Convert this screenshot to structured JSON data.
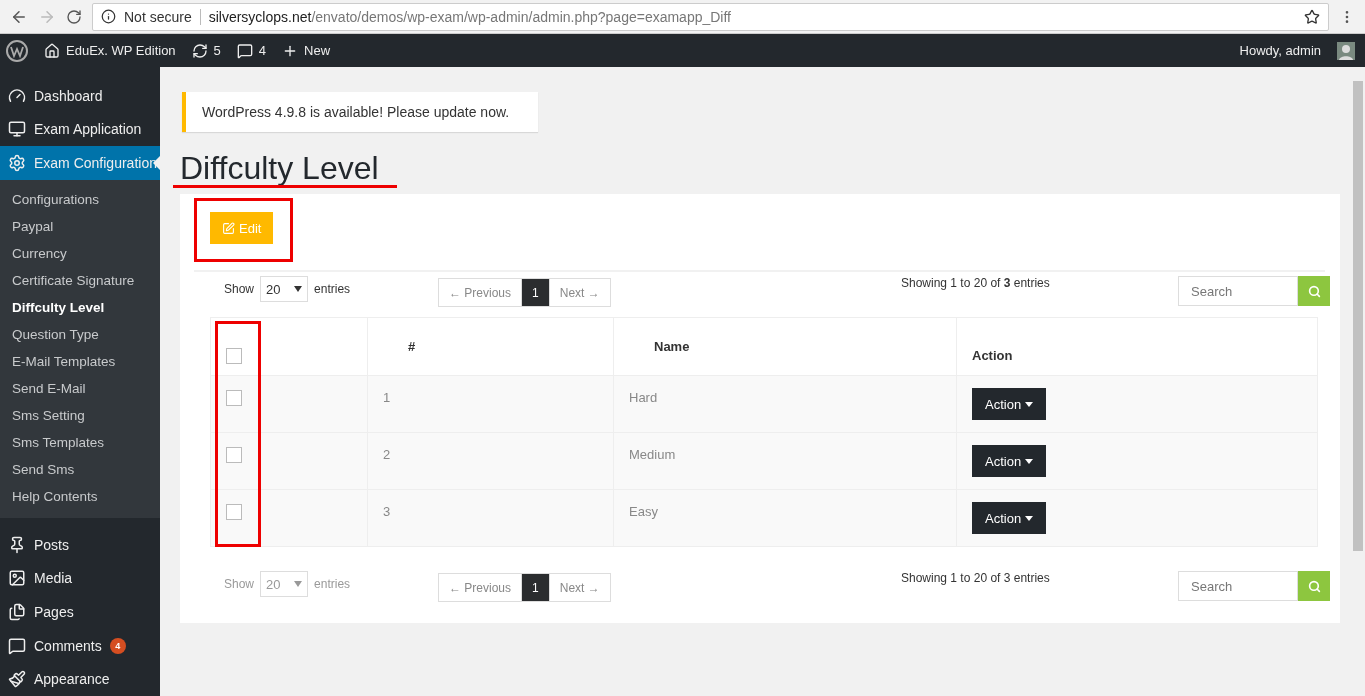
{
  "browser": {
    "security": "Not secure",
    "url_host": "silversyclops.net",
    "url_path": "/envato/demos/wp-exam/wp-admin/admin.php?page=examapp_Diff"
  },
  "admin_bar": {
    "site": "EduEx. WP Edition",
    "updates": "5",
    "comments": "4",
    "new": "New",
    "greeting": "Howdy, admin"
  },
  "sidebar": {
    "menu": [
      {
        "label": "Dashboard",
        "selected": false
      },
      {
        "label": "Exam Application",
        "selected": false
      },
      {
        "label": "Exam Configuration",
        "selected": true
      }
    ],
    "submenu": [
      {
        "label": "Configurations",
        "selected": false
      },
      {
        "label": "Paypal",
        "selected": false
      },
      {
        "label": "Currency",
        "selected": false
      },
      {
        "label": "Certificate Signature",
        "selected": false
      },
      {
        "label": "Diffculty Level",
        "selected": true
      },
      {
        "label": "Question Type",
        "selected": false
      },
      {
        "label": "E-Mail Templates",
        "selected": false
      },
      {
        "label": "Send E-Mail",
        "selected": false
      },
      {
        "label": "Sms Setting",
        "selected": false
      },
      {
        "label": "Sms Templates",
        "selected": false
      },
      {
        "label": "Send Sms",
        "selected": false
      },
      {
        "label": "Help Contents",
        "selected": false
      }
    ],
    "menu_after": [
      {
        "label": "Posts"
      },
      {
        "label": "Media"
      },
      {
        "label": "Pages"
      },
      {
        "label": "Comments",
        "badge": "4"
      },
      {
        "label": "Appearance"
      }
    ]
  },
  "notice": "WordPress 4.9.8 is available! Please update now.",
  "page_title": "Diffculty Level",
  "edit_button": "Edit",
  "controls": [
    {
      "show_label": "Show",
      "length": "20",
      "entries_label": "entries",
      "disabled": false,
      "previous": "← Previous",
      "pages": [
        {
          "label": "1",
          "selected": true
        }
      ],
      "next": "Next →",
      "info": "Showing 1 to 20 of **3** entries",
      "search_placeholder": "Search"
    },
    {
      "show_label": "Show",
      "length": "20",
      "entries_label": "entries",
      "disabled": true,
      "previous": "← Previous",
      "pages": [
        {
          "label": "1",
          "selected": true
        }
      ],
      "next": "Next →",
      "info": "Showing 1 to 20 of 3 entries",
      "search_placeholder": "Search"
    }
  ],
  "table": {
    "header_checked": false,
    "columns": [
      "#",
      "Name",
      "Action"
    ],
    "rows": [
      {
        "checked": false,
        "number": "1",
        "name": "Hard",
        "action": "Action"
      },
      {
        "checked": false,
        "number": "2",
        "name": "Medium",
        "action": "Action"
      },
      {
        "checked": false,
        "number": "3",
        "name": "Easy",
        "action": "Action"
      }
    ]
  }
}
